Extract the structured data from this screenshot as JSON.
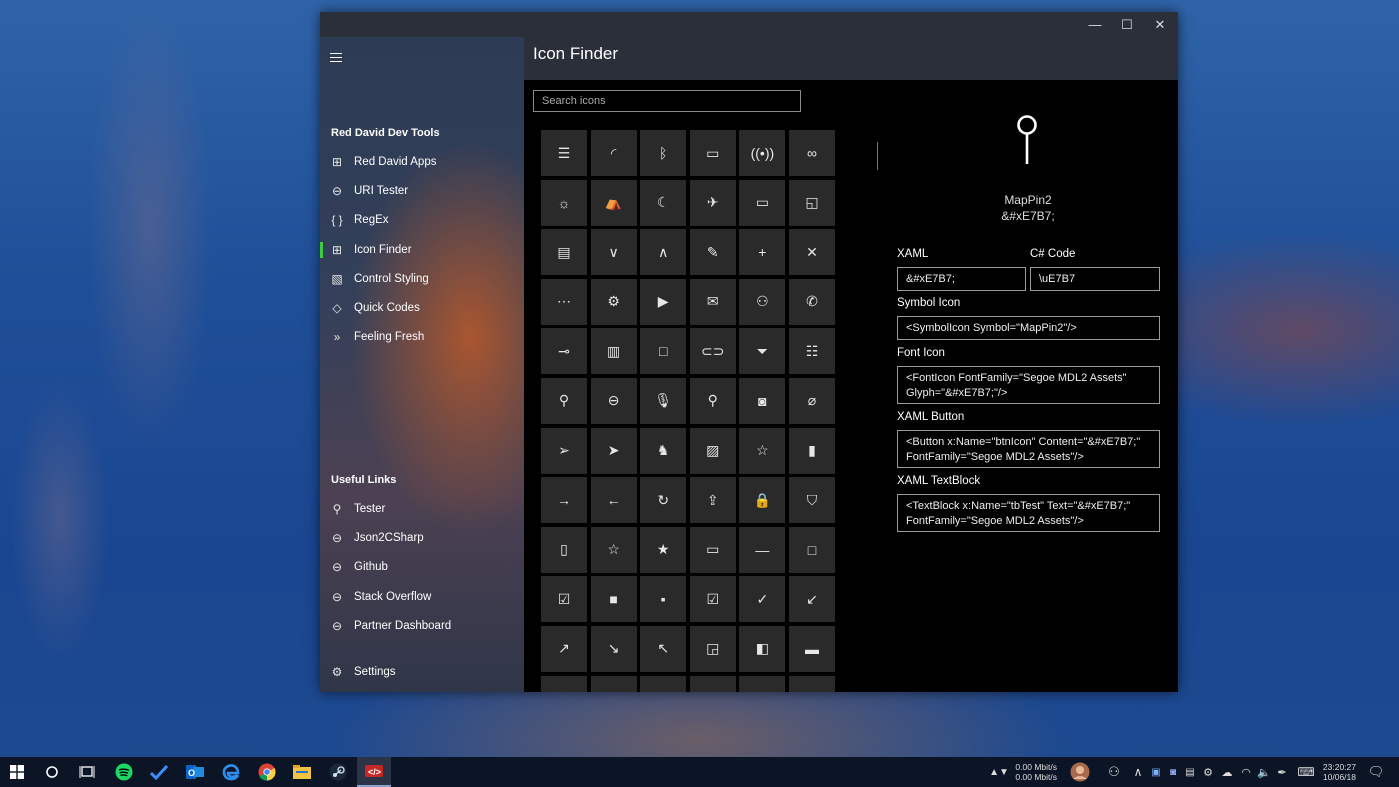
{
  "window": {
    "minimize": "—",
    "maximize": "☐",
    "close": "✕"
  },
  "sidebar": {
    "section1_title": "Red David Dev Tools",
    "items": [
      {
        "label": "Red David Apps",
        "icon": "⊞",
        "icon_name": "apps-icon"
      },
      {
        "label": "URI Tester",
        "icon": "⊖",
        "icon_name": "link-icon"
      },
      {
        "label": "RegEx",
        "icon": "{ }",
        "icon_name": "braces-icon"
      },
      {
        "label": "Icon Finder",
        "icon": "⊞",
        "icon_name": "icon-grid-icon",
        "selected": true
      },
      {
        "label": "Control Styling",
        "icon": "▧",
        "icon_name": "styling-icon"
      },
      {
        "label": "Quick Codes",
        "icon": "◇",
        "icon_name": "quick-codes-icon"
      },
      {
        "label": "Feeling Fresh",
        "icon": "»",
        "icon_name": "fresh-icon"
      }
    ],
    "section2_title": "Useful Links",
    "links": [
      {
        "label": "Tester",
        "icon": "⚲",
        "icon_name": "wrench-icon"
      },
      {
        "label": "Json2CSharp",
        "icon": "⊖",
        "icon_name": "globe-icon"
      },
      {
        "label": "Github",
        "icon": "⊖",
        "icon_name": "globe-icon"
      },
      {
        "label": "Stack Overflow",
        "icon": "⊖",
        "icon_name": "globe-icon"
      },
      {
        "label": "Partner Dashboard",
        "icon": "⊖",
        "icon_name": "globe-icon"
      }
    ],
    "settings": {
      "label": "Settings",
      "icon": "⚙"
    }
  },
  "header": {
    "title": "Icon Finder"
  },
  "search": {
    "placeholder": "Search icons"
  },
  "icons": [
    "☰",
    "◜",
    "ᛒ",
    "▭",
    "((•))",
    "∞",
    "☼",
    "⛺",
    "☾",
    "✈",
    "▭",
    "◱",
    "▤",
    "∨",
    "∧",
    "✎",
    "+",
    "✕",
    "⋯",
    "⚙",
    "▶",
    "✉",
    "⚇",
    "✆",
    "⊸",
    "▥",
    "□",
    "⊂⊃",
    "⏷",
    "☷",
    "⚲",
    "⊖",
    "🎙",
    "⚲",
    "◙",
    "⌀",
    "➢",
    "➤",
    "♞",
    "▨",
    "☆",
    "▮",
    "→",
    "←",
    "↻",
    "⇪",
    "🔒",
    "⛉",
    "▯",
    "☆",
    "★",
    "▭",
    "—",
    "□",
    "☑",
    "■",
    "▪",
    "☑",
    "✓",
    "↙",
    "↗",
    "↘",
    "↖",
    "◲",
    "◧",
    "▬",
    "▭",
    "▭",
    "▭",
    "▭",
    "▭",
    "▭"
  ],
  "detail": {
    "glyph_name": "MapPin2",
    "glyph_code": "&#xE7B7;",
    "xaml_label": "XAML",
    "xaml_value": "&#xE7B7;",
    "csharp_label": "C# Code",
    "csharp_value": "\\uE7B7",
    "symbol_label": "Symbol Icon",
    "symbol_value": "<SymbolIcon Symbol=\"MapPin2\"/>",
    "font_label": "Font Icon",
    "font_value": "<FontIcon FontFamily=\"Segoe MDL2 Assets\"\nGlyph=\"&#xE7B7;\"/>",
    "button_label": "XAML Button",
    "button_value": "<Button x:Name=\"btnIcon\" Content=\"&#xE7B7;\"\nFontFamily=\"Segoe MDL2 Assets\"/>",
    "textblock_label": "XAML TextBlock",
    "textblock_value": "<TextBlock x:Name=\"tbTest\" Text=\"&#xE7B7;\"\nFontFamily=\"Segoe MDL2 Assets\"/>"
  },
  "taskbar": {
    "net_up": "0.00 Mbit/s",
    "net_down": "0.00 Mbit/s",
    "time": "23:20:27",
    "date": "10/06/18"
  }
}
